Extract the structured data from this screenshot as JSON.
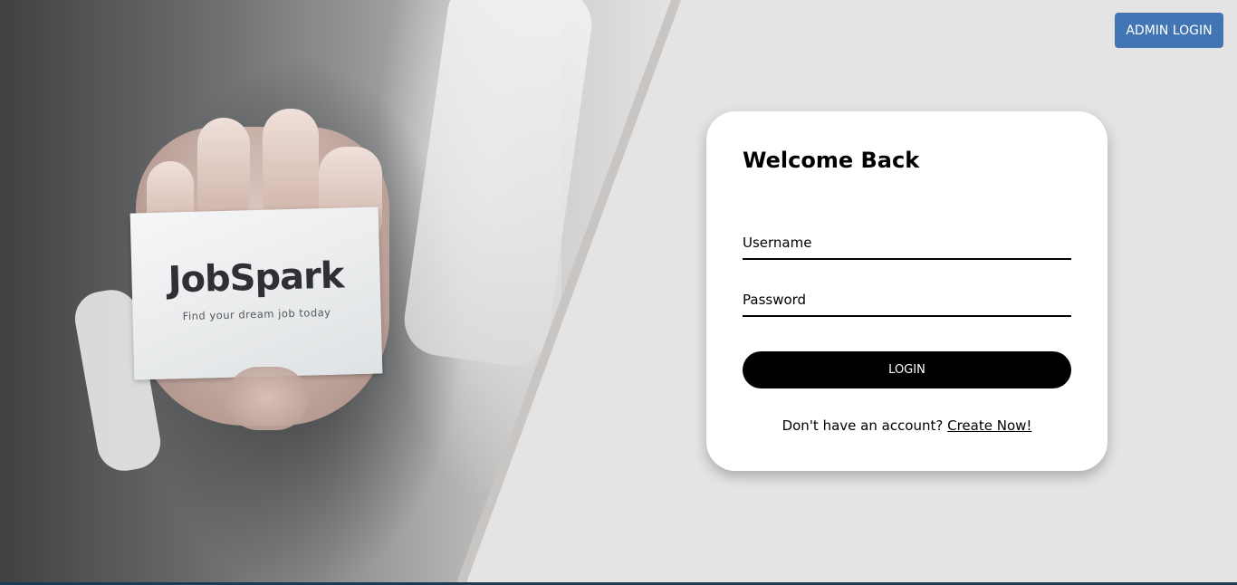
{
  "hero": {
    "brand": "JobSpark",
    "tagline": "Find your dream job today"
  },
  "header": {
    "admin_login_label": "ADMIN LOGIN"
  },
  "login": {
    "title": "Welcome Back",
    "username_placeholder": "Username",
    "username_value": "",
    "password_placeholder": "Password",
    "password_value": "",
    "submit_label": "LOGIN",
    "signup_prompt": "Don't have an account?",
    "signup_link": "Create Now!"
  },
  "colors": {
    "background": "#e4e4e4",
    "admin_button": "#4275b3",
    "login_button": "#000000",
    "divider": "#c8c5c3"
  }
}
